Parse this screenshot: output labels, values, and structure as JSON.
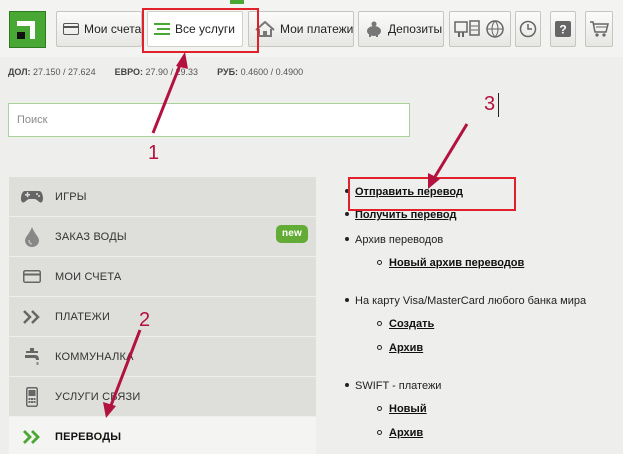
{
  "toolbar": {
    "tabs": [
      {
        "label": "Мои счета",
        "icon": "card-icon"
      },
      {
        "label": "Все услуги",
        "icon": "list-icon"
      },
      {
        "label": "Мои платежи",
        "icon": "house-icon"
      },
      {
        "label": "Депозиты",
        "icon": "piggy-bank-icon"
      }
    ],
    "icon_buttons": [
      "services-icon",
      "globe-icon",
      "clock-icon",
      "help-icon",
      "cart-icon"
    ]
  },
  "rates": {
    "usd_label": "ДОЛ:",
    "usd_value": "27.150 / 27.624",
    "eur_label": "ЕВРО:",
    "eur_value": "27.90 / 29.33",
    "rub_label": "РУБ:",
    "rub_value": "0.4600 / 0.4900"
  },
  "search": {
    "placeholder": "Поиск",
    "value": ""
  },
  "menu": {
    "items": [
      {
        "label": "ИГРЫ",
        "icon": "gamepad-icon"
      },
      {
        "label": "ЗАКАЗ ВОДЫ",
        "icon": "water-drop-icon",
        "badge": "new"
      },
      {
        "label": "МОИ СЧЕТА",
        "icon": "card-icon"
      },
      {
        "label": "ПЛАТЕЖИ",
        "icon": "double-chevron-icon"
      },
      {
        "label": "КОММУНАЛКА",
        "icon": "faucet-icon"
      },
      {
        "label": "УСЛУГИ СВЯЗИ",
        "icon": "phone-icon"
      },
      {
        "label": "ПЕРЕВОДЫ",
        "icon": "double-chevron-green-icon"
      }
    ]
  },
  "transfers": {
    "send": "Отправить перевод",
    "receive": "Получить перевод",
    "archive": "Архив переводов",
    "new_archive": "Новый архив переводов",
    "card_transfer": "На карту Visa/MasterCard любого банка мира",
    "create": "Создать",
    "card_archive": "Архив",
    "swift": "SWIFT - платежи",
    "swift_new": "Новый",
    "swift_archive": "Архив"
  },
  "annotations": {
    "n1": "1",
    "n2": "2",
    "n3": "3"
  },
  "colors": {
    "brand_green": "#49a833",
    "annotation_red": "#e0202a",
    "arrow": "#b3123f"
  }
}
